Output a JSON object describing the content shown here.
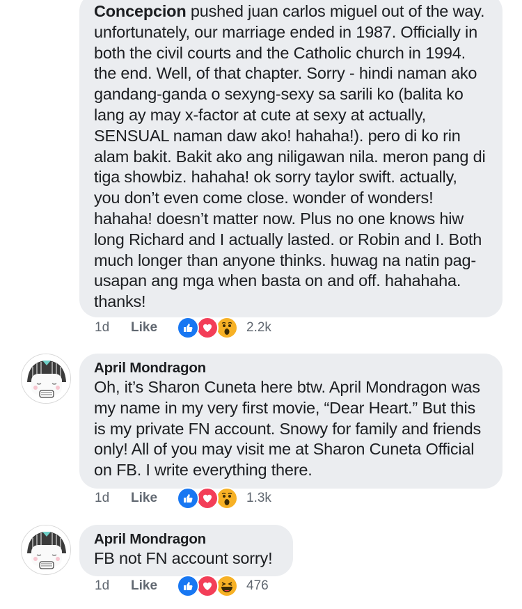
{
  "comments": [
    {
      "inline_author": "Concepcion",
      "text": "pushed juan carlos miguel out of the way. unfortunately, our marriage ended in 1987. Officially in both the civil courts and the Catholic church in 1994. the end. Well, of that chapter. Sorry - hindi naman ako gandang-ganda o sexyng-sexy sa sarili ko (balita ko lang ay may x-factor at cute at sexy at actually, SENSUAL naman daw ako! hahaha!). pero di ko rin alam bakit. Bakit ako ang niligawan nila. meron pang di tiga showbiz. hahaha! ok sorry taylor swift. actually, you don’t even come close. wonder of wonders! hahaha! doesn’t matter now. Plus no one knows hiw long Richard and I actually lasted. or Robin and I. Both much longer than anyone thinks. huwag na natin pag-usapan ang mga when basta on and off. hahahaha. thanks!",
      "time": "1d",
      "like_label": "Like",
      "reactions": [
        "like-icon",
        "love-icon",
        "wow-icon"
      ],
      "reaction_count": "2.2k"
    },
    {
      "author": "April Mondragon",
      "text": "Oh, it’s Sharon Cuneta here btw. April Mondragon was my name in my very first movie, “Dear Heart.” But this is my private FN account. Snowy for family and friends only! All of you may visit me at Sharon Cuneta Official on FB. I write everything there.",
      "time": "1d",
      "like_label": "Like",
      "reactions": [
        "like-icon",
        "love-icon",
        "wow-icon"
      ],
      "reaction_count": "1.3k"
    },
    {
      "author": "April Mondragon",
      "text": "FB not FN account sorry!",
      "time": "1d",
      "like_label": "Like",
      "reactions": [
        "like-icon",
        "love-icon",
        "haha-icon"
      ],
      "reaction_count": "476"
    }
  ],
  "colors": {
    "bubble": "#ebedf0",
    "like_blue": "#1877f2",
    "love_red": "#f33e58",
    "emoji_yellow": "#f7b125",
    "meta_gray": "#606770"
  }
}
